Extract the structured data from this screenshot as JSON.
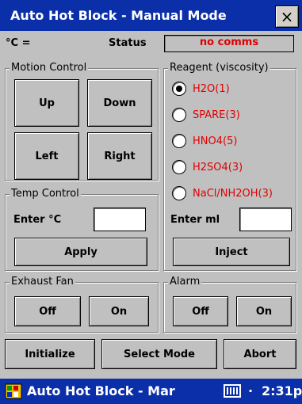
{
  "window": {
    "title": "Auto Hot Block - Manual Mode",
    "close_label": "×"
  },
  "header": {
    "temp_unit_label": "°C =",
    "status_label": "Status",
    "status_value": "no comms"
  },
  "motion": {
    "legend": "Motion Control",
    "up": "Up",
    "down": "Down",
    "left": "Left",
    "right": "Right"
  },
  "reagent": {
    "legend": "Reagent (viscosity)",
    "options": [
      "H2O(1)",
      "SPARE(3)",
      "HNO4(5)",
      "H2SO4(3)",
      "NaCl/NH2OH(3)"
    ],
    "selected": "H2O(1)",
    "enter_label": "Enter ml",
    "input_value": "",
    "inject_label": "Inject"
  },
  "temp": {
    "legend": "Temp Control",
    "enter_label": "Enter °C",
    "input_value": "",
    "apply_label": "Apply"
  },
  "exhaust": {
    "legend": "Exhaust Fan",
    "off": "Off",
    "on": "On"
  },
  "alarm": {
    "legend": "Alarm",
    "off": "Off",
    "on": "On"
  },
  "bottom": {
    "initialize": "Initialize",
    "select_mode": "Select Mode",
    "abort": "Abort"
  },
  "taskbar": {
    "app_title": "Auto Hot Block - Mar",
    "arrow": "·",
    "time": "2:31p"
  },
  "colors": {
    "titlebar": "#0a2fa8",
    "alert_text": "#e00000",
    "window_bg": "#c0c0c0"
  }
}
